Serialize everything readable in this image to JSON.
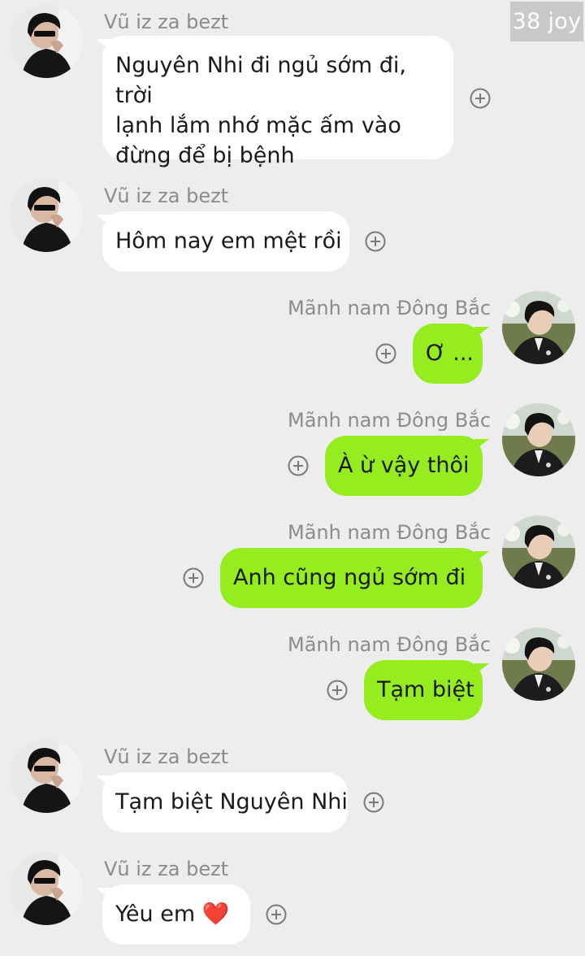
{
  "watermark": "38 joy",
  "messages": [
    {
      "side": "left",
      "sender": "Vũ iz za bezt",
      "lines": [
        "Nguyên Nhi đi ngủ sớm đi, trời",
        "lạnh lắm nhớ mặc ấm vào",
        "đừng để bị bệnh"
      ]
    },
    {
      "side": "left",
      "sender": "Vũ iz za bezt",
      "text": "Hôm nay em mệt rồi"
    },
    {
      "side": "right",
      "sender": "Mãnh nam Đông Bắc",
      "text": "Ơ ..."
    },
    {
      "side": "right",
      "sender": "Mãnh nam Đông Bắc",
      "text": "À ừ vậy thôi"
    },
    {
      "side": "right",
      "sender": "Mãnh nam Đông Bắc",
      "text": "Anh cũng ngủ sớm đi"
    },
    {
      "side": "right",
      "sender": "Mãnh nam Đông Bắc",
      "text": "Tạm biệt"
    },
    {
      "side": "left",
      "sender": "Vũ iz za bezt",
      "text": "Tạm biệt Nguyên Nhi"
    },
    {
      "side": "left",
      "sender": "Vũ iz za bezt",
      "text": "Yêu em ❤️"
    }
  ],
  "icons": {
    "react": "plus-circle-icon",
    "heart": "heart-icon"
  },
  "colors": {
    "background": "#ededed",
    "left_bubble": "#ffffff",
    "right_bubble": "#95ec1f",
    "name_text": "#8c8c8c",
    "heart": "#e0202a"
  }
}
